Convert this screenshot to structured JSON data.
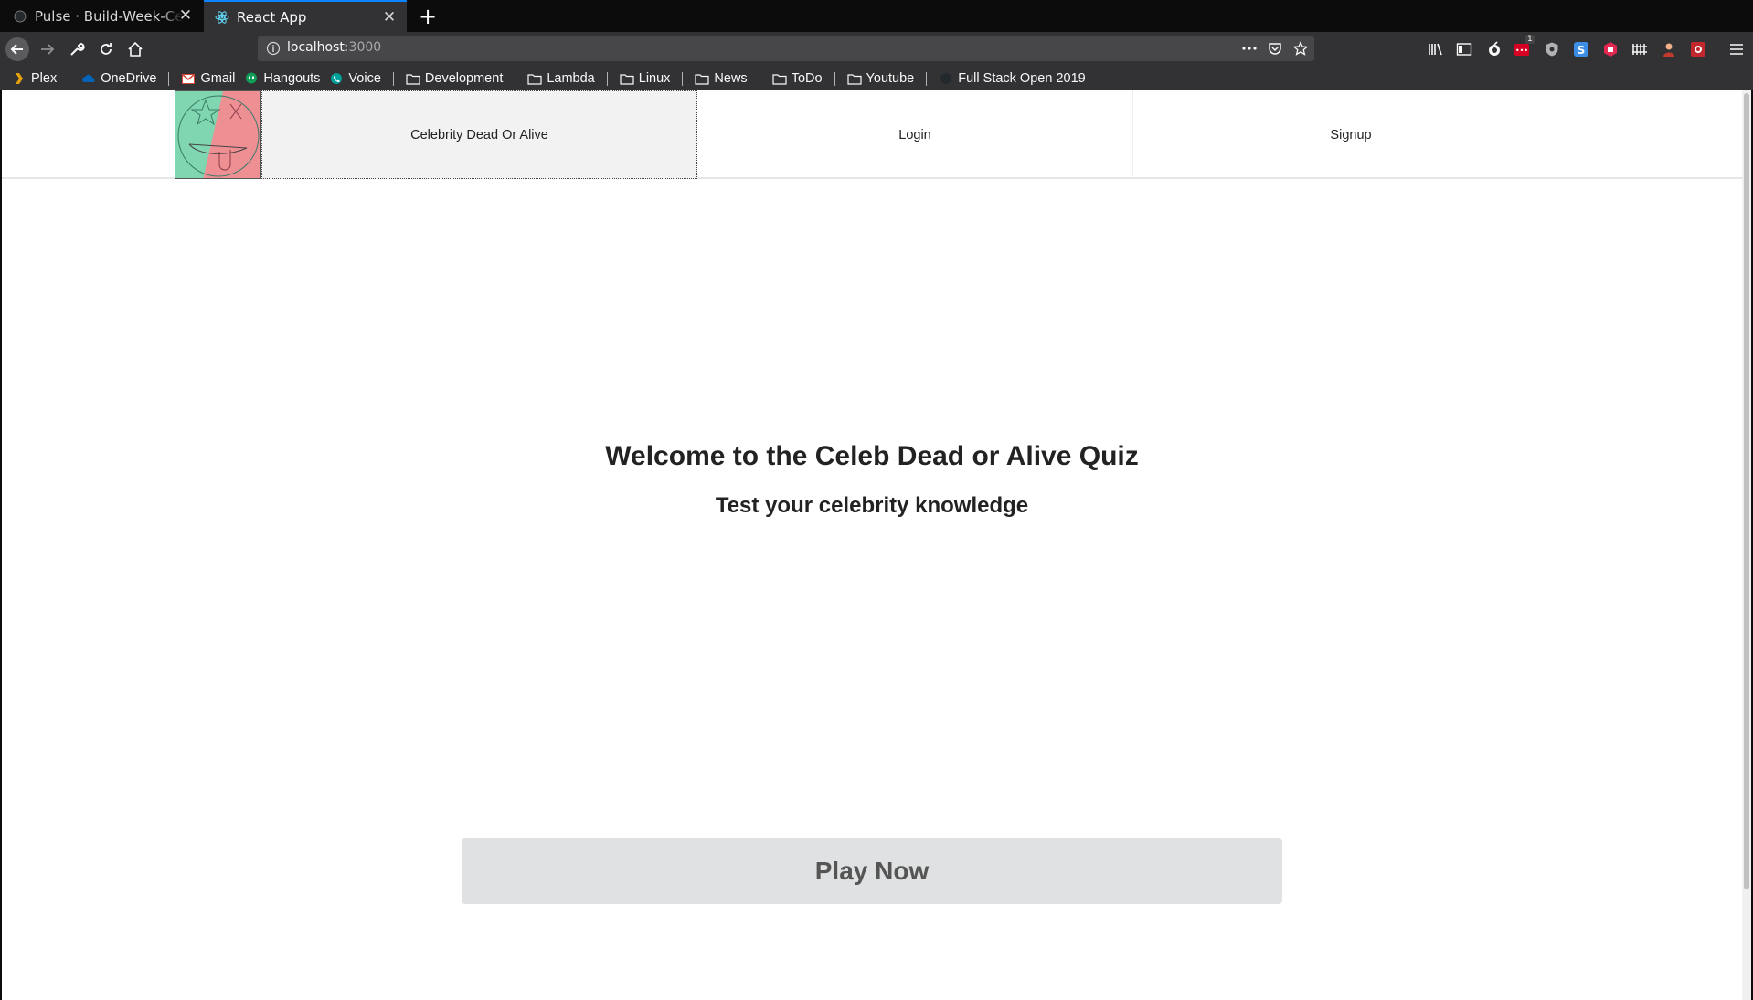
{
  "browser": {
    "tabs": [
      {
        "title": "Pulse · Build-Week-Celeb",
        "icon": "pulse-icon",
        "active": false
      },
      {
        "title": "React App",
        "icon": "react-icon",
        "active": true
      }
    ],
    "new_tab_label": "+",
    "address_bar": {
      "host": "localhost",
      "port": ":3000"
    },
    "address_actions": [
      "page-actions-icon",
      "pocket-icon",
      "bookmark-star-icon"
    ],
    "toolbar_icons": [
      "library-icon",
      "sidebar-icon",
      "extension-icon",
      "extension-badge-icon",
      "privacy-icon",
      "extension-s-icon",
      "extension-red-icon",
      "extension-bars-icon",
      "extension-person-icon",
      "extension-square-icon",
      "menu-icon"
    ],
    "extension_badge_count": "1",
    "bookmarks": [
      {
        "label": "Plex",
        "icon": "plex-icon"
      },
      {
        "label": "OneDrive",
        "icon": "onedrive-icon"
      },
      {
        "label": "Gmail",
        "icon": "gmail-icon"
      },
      {
        "label": "Hangouts",
        "icon": "hangouts-icon"
      },
      {
        "label": "Voice",
        "icon": "voice-icon"
      },
      {
        "label": "Development",
        "icon": "folder-icon"
      },
      {
        "label": "Lambda",
        "icon": "folder-icon"
      },
      {
        "label": "Linux",
        "icon": "folder-icon"
      },
      {
        "label": "News",
        "icon": "folder-icon"
      },
      {
        "label": "ToDo",
        "icon": "folder-icon"
      },
      {
        "label": "Youtube",
        "icon": "folder-icon"
      },
      {
        "label": "Full Stack Open 2019",
        "icon": "github-icon"
      }
    ],
    "colors": {
      "chrome_bg": "#0c0c0d",
      "toolbar_bg": "#323234",
      "accent": "#0a84ff"
    }
  },
  "site": {
    "nav": {
      "home_label": "Celebrity Dead Or Alive",
      "login_label": "Login",
      "signup_label": "Signup"
    },
    "logo": {
      "name": "dead-or-alive-logo",
      "colors": [
        "#7fd6b0",
        "#ee8f94"
      ]
    },
    "hero": {
      "title": "Welcome to the Celeb Dead or Alive Quiz",
      "subtitle": "Test your celebrity knowledge"
    },
    "play_button": {
      "label": "Play Now",
      "color": "#e0e1e2"
    }
  }
}
